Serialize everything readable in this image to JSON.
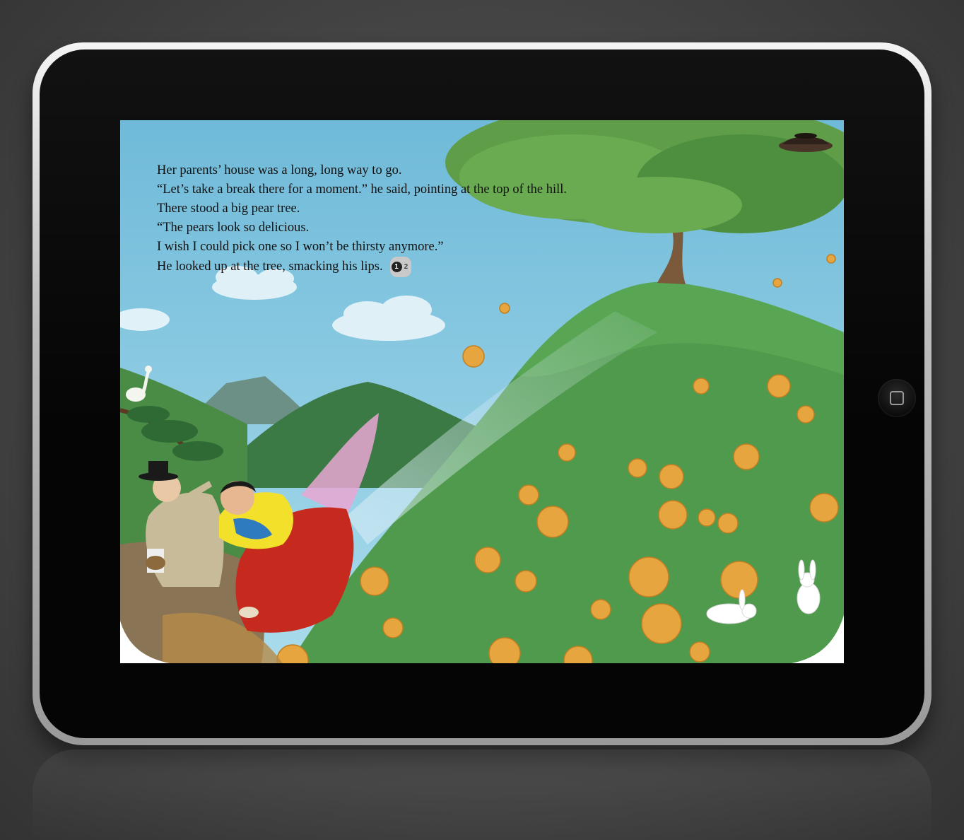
{
  "story": {
    "lines": [
      "Her parents’ house was a long, long way to go.",
      "“Let’s take a break there for a moment.” he said, pointing at the top of the hill.",
      "There stood a big pear tree.",
      "“The pears look so delicious.",
      "I wish I could pick one so I won’t be thirsty anymore.”",
      "He looked up at the tree, smacking his lips."
    ]
  },
  "page_indicator": {
    "current": "1",
    "total": "2"
  },
  "icons": {
    "home": "home-square-icon",
    "pot": "pot-lid-icon",
    "page_curl": "page-curl-icon"
  },
  "colors": {
    "sky": "#7fc4e0",
    "hill": "#4f9a4c",
    "pear": "#e6a53e",
    "dress": "#c62a1e",
    "jacket": "#f3e02a"
  }
}
